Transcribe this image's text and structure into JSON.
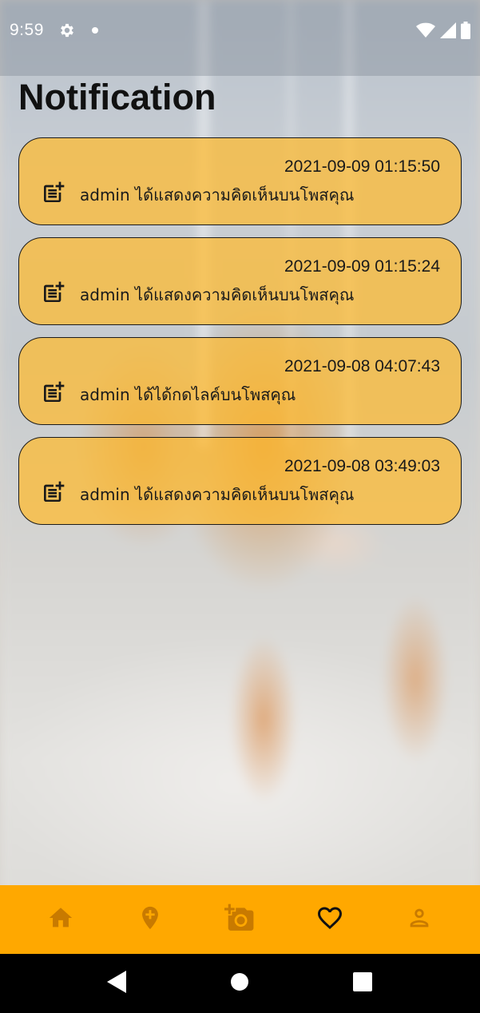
{
  "status_bar": {
    "time": "9:59"
  },
  "page": {
    "title": "Notification"
  },
  "notifications": [
    {
      "timestamp": "2021-09-09 01:15:50",
      "message": "admin ได้แสดงความคิดเห็นบนโพสคุณ",
      "icon": "post-add-icon"
    },
    {
      "timestamp": "2021-09-09 01:15:24",
      "message": "admin ได้แสดงความคิดเห็นบนโพสคุณ",
      "icon": "post-add-icon"
    },
    {
      "timestamp": "2021-09-08 04:07:43",
      "message": "admin ได้ได้กดไลค์บนโพสคุณ",
      "icon": "post-add-icon"
    },
    {
      "timestamp": "2021-09-08 03:49:03",
      "message": "admin ได้แสดงความคิดเห็นบนโพสคุณ",
      "icon": "post-add-icon"
    }
  ],
  "bottom_nav": {
    "items": [
      "home-icon",
      "add-location-icon",
      "add-photo-icon",
      "favorite-icon",
      "person-icon"
    ],
    "active": "favorite-icon"
  },
  "colors": {
    "accent": "#ffa800",
    "card_fill": "#ffba2c",
    "text": "#1a1a1a"
  }
}
